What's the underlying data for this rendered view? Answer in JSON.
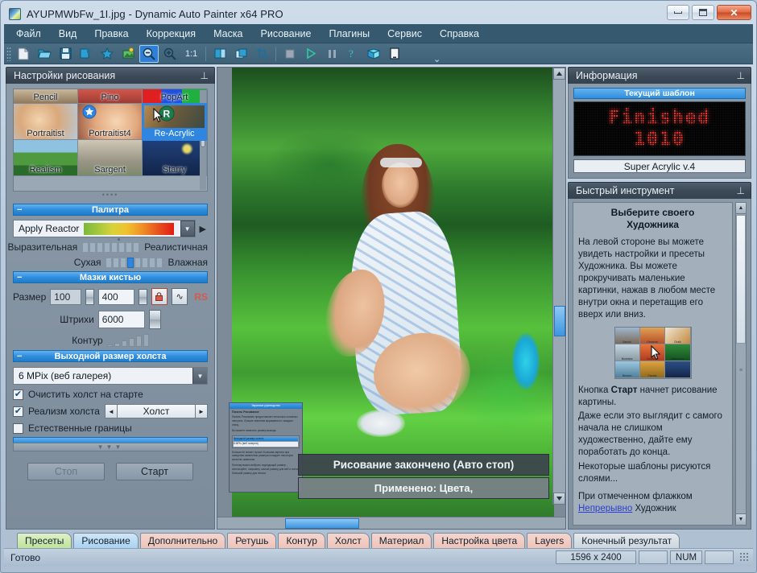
{
  "window": {
    "title": "AYUPMWbFw_1I.jpg - Dynamic Auto Painter x64 PRO",
    "minimize_label": "",
    "maximize_label": "",
    "close_label": "✕"
  },
  "menu": {
    "items": [
      {
        "label": "Файл"
      },
      {
        "label": "Вид"
      },
      {
        "label": "Правка"
      },
      {
        "label": "Коррекция"
      },
      {
        "label": "Маска"
      },
      {
        "label": "Рисование"
      },
      {
        "label": "Плагины"
      },
      {
        "label": "Сервис"
      },
      {
        "label": "Справка"
      }
    ]
  },
  "toolbar": {
    "buttons": [
      {
        "icon": "new-document-icon",
        "active": false
      },
      {
        "icon": "open-folder-icon",
        "active": false
      },
      {
        "icon": "save-diskette-icon",
        "active": false
      },
      {
        "icon": "save-as-icon",
        "active": false
      },
      {
        "icon": "star-favorite-icon",
        "active": false
      },
      {
        "icon": "image-effects-icon",
        "active": false
      },
      {
        "icon": "zoom-out-icon",
        "active": true
      },
      {
        "icon": "zoom-in-icon",
        "active": false
      }
    ],
    "zoom_label": "1:1",
    "buttons2": [
      {
        "icon": "fit-window-icon",
        "active": false
      },
      {
        "icon": "fit-width-icon",
        "active": false
      },
      {
        "icon": "crop-icon",
        "active": false
      },
      {
        "icon": "stop-square-icon",
        "active": false
      },
      {
        "icon": "play-triangle-icon",
        "active": false
      },
      {
        "icon": "pause-icon",
        "active": false
      },
      {
        "icon": "help-question-icon",
        "active": false
      },
      {
        "icon": "book-icon",
        "active": false
      },
      {
        "icon": "tablet-icon",
        "active": false
      }
    ],
    "overflow_label": "⌄"
  },
  "left_panel": {
    "title": "Настройки рисования",
    "pin": "⊥",
    "presets": {
      "top_row": [
        {
          "label": "Pencil"
        },
        {
          "label": "Pino"
        },
        {
          "label": "PopArt"
        }
      ],
      "rows": [
        [
          {
            "label": "Portraitist",
            "selected": false
          },
          {
            "label": "Portraitist4",
            "selected": false
          },
          {
            "label": "Re-Acrylic",
            "selected": true
          }
        ],
        [
          {
            "label": "Realism",
            "selected": false
          },
          {
            "label": "Sargent",
            "selected": false
          },
          {
            "label": "Starry",
            "selected": false
          }
        ]
      ],
      "dots": "••••"
    },
    "palette": {
      "section_title": "Палитра",
      "collapse": "−",
      "combo_value": "Apply Reactor",
      "dropdown_arrow": "▼",
      "next_arrow": "▶"
    },
    "sliders": [
      {
        "left_label": "Выразительная",
        "right_label": "Реалистичная",
        "value_index": 5,
        "ticks": 8
      },
      {
        "left_label": "Сухая",
        "right_label": "Влажная",
        "value_index": 3,
        "ticks": 8
      }
    ],
    "brush": {
      "section_title": "Мазки кистью",
      "collapse": "−",
      "size_label": "Размер",
      "size_min": "100",
      "size_max": "400",
      "lock_icon": "🔒",
      "wave_icon": "∿",
      "rs_label": "RS",
      "strokes_label": "Штрихи",
      "strokes_value": "6000",
      "contour_label": "Контур"
    },
    "canvas_size": {
      "section_title": "Выходной размер холста",
      "collapse": "−",
      "value": "6 MPix (веб галерея)",
      "dropdown_arrow": "▼",
      "checkboxes": [
        {
          "label": "Очистить холст на старте",
          "checked": true
        },
        {
          "label": "Реализм холста",
          "checked": true
        },
        {
          "label": "Естественные границы",
          "checked": false
        }
      ],
      "canvas_spinner_value": "Холст",
      "spin_left": "◄",
      "spin_right": "►"
    },
    "splitter_dots": "▼▼▼",
    "buttons": {
      "stop_label": "Стоп",
      "start_label": "Старт"
    }
  },
  "canvas": {
    "overlay_line1": "Рисование закончено (Авто стоп)",
    "overlay_line2": "Применено:   Цвета,",
    "float_help": {
      "titlebar": "Экранное руководство",
      "heading": "Панель Рисование",
      "paragraph1": "Панель Рисование предоставляет несколько основных настроек. Лучшие значения выражаются с каждым снизу.",
      "paragraph2": "Вы можете изменить размер вывода.",
      "section_title": "Выходной размер холста",
      "field_value": "6 MPix (веб галерея)",
      "paragraph3": "Больше не значит лучше! Большая картина при смещении изменения размера попадает некоторое качество живописи.",
      "paragraph4": "Поэтому важно выбрать подходящий размер - используйте, например, малый размер для веб и очень большой размер для печати."
    }
  },
  "right_panel": {
    "info": {
      "title": "Информация",
      "pin": "⊥",
      "current_template_label": "Текущий шаблон",
      "led_line1": "Finished",
      "led_line2": "1010",
      "template_name": "Super Acrylic v.4"
    },
    "quick_tool": {
      "title": "Быстрый инструмент",
      "pin": "⊥",
      "heading_line1": "Выберите своего",
      "heading_line2": "Художника",
      "paragraph1": "На левой стороне вы можете увидеть настройки и пресеты Художника. Вы можете прокручивать маленькие картинки, нажав в любом месте внутри окна и перетащив его вверх или вниз.",
      "thumbs": [
        {
          "label": "Barock"
        },
        {
          "label": "Cezanne"
        },
        {
          "label": "Chalk"
        },
        {
          "label": "Illustrator"
        },
        {
          "label": "Gouache"
        },
        {
          "label": "Watercolor"
        },
        {
          "label": "Benson"
        },
        {
          "label": "Fauvist"
        },
        {
          "label": "Starry"
        }
      ],
      "paragraph2_pre": "Кнопка ",
      "paragraph2_bold": "Старт",
      "paragraph2_post": " начнет рисование картины.",
      "paragraph3": "Даже если это выглядит с самого начала не слишком художественно, дайте ему поработать до конца.",
      "paragraph4": "Некоторые шаблоны рисуются слоями...",
      "paragraph5_pre": "При отмеченном флажком",
      "paragraph5_link": "Непрерывно",
      "paragraph5_post": " Художник",
      "scroll_up": "▲",
      "scroll_down": "▼"
    }
  },
  "tabs": [
    {
      "label": "Пресеты",
      "style": "green",
      "active": true
    },
    {
      "label": "Рисование",
      "style": "blue",
      "active": false
    },
    {
      "label": "Дополнительно",
      "style": "pink",
      "active": false
    },
    {
      "label": "Ретушь",
      "style": "pink",
      "active": false
    },
    {
      "label": "Контур",
      "style": "pink",
      "active": false
    },
    {
      "label": "Холст",
      "style": "pink",
      "active": false
    },
    {
      "label": "Материал",
      "style": "pink",
      "active": false
    },
    {
      "label": "Настройка цвета",
      "style": "pink",
      "active": false
    },
    {
      "label": "Layers",
      "style": "pink",
      "active": false
    },
    {
      "label": "Конечный результат",
      "style": "gray",
      "active": false
    }
  ],
  "statusbar": {
    "message": "Готово",
    "dimensions": "1596 x 2400",
    "cell_empty1": "",
    "num_lock": "NUM",
    "cell_empty2": ""
  }
}
